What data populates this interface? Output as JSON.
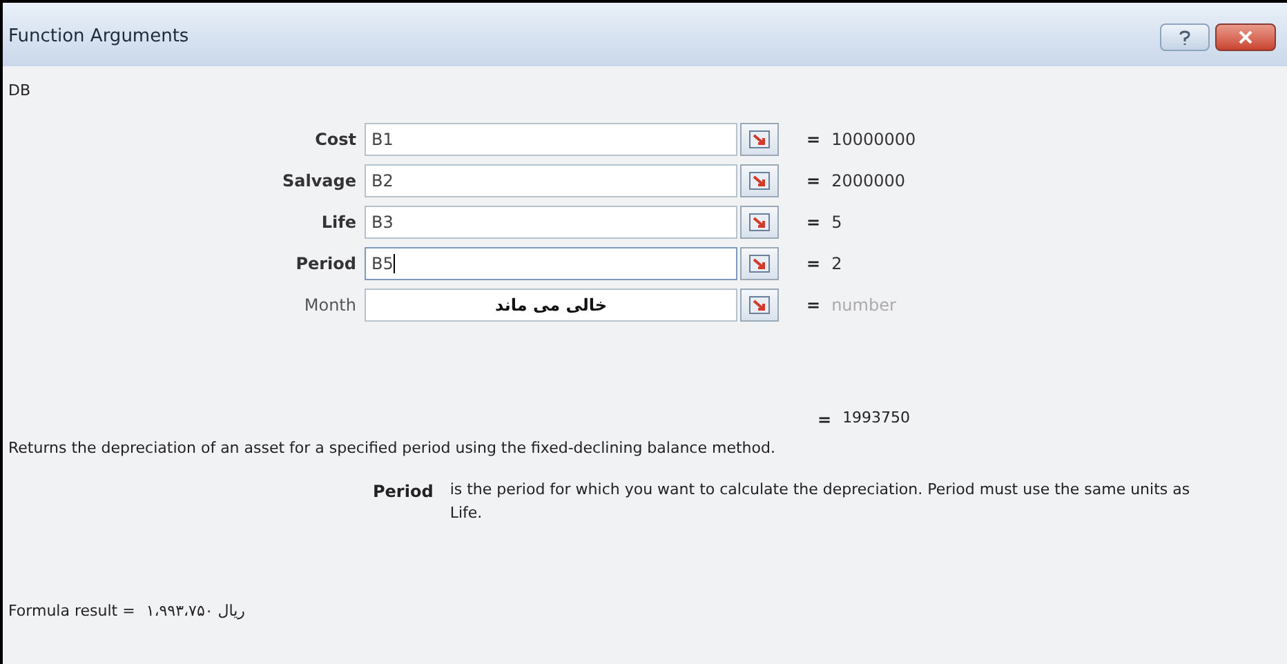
{
  "window": {
    "title": "Function Arguments"
  },
  "function_name": "DB",
  "arguments": [
    {
      "label": "Cost",
      "required": true,
      "value": "B1",
      "result": "10000000",
      "result_placeholder": false,
      "focused": false
    },
    {
      "label": "Salvage",
      "required": true,
      "value": "B2",
      "result": "2000000",
      "result_placeholder": false,
      "focused": false
    },
    {
      "label": "Life",
      "required": true,
      "value": "B3",
      "result": "5",
      "result_placeholder": false,
      "focused": false
    },
    {
      "label": "Period",
      "required": true,
      "value": "B5",
      "result": "2",
      "result_placeholder": false,
      "focused": true
    },
    {
      "label": "Month",
      "required": false,
      "value": "خالی می ماند",
      "result": "number",
      "result_placeholder": true,
      "focused": false
    }
  ],
  "equals_sign": "=",
  "overall_result": "1993750",
  "description": "Returns the depreciation of an asset for a specified period using the fixed-declining balance method.",
  "argument_help": {
    "label": "Period",
    "text": "is the period for which you want to calculate the depreciation. Period must use the same units as Life."
  },
  "formula_result": {
    "label": "Formula result =",
    "value": "۱،۹۹۳،۷۵۰ ریال"
  }
}
